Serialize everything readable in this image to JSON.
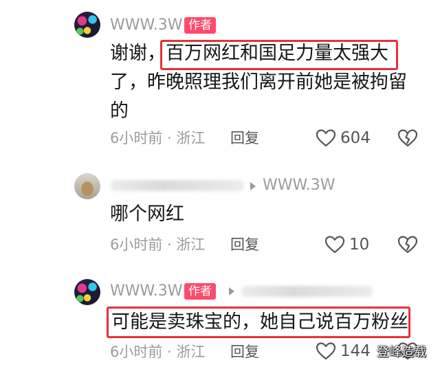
{
  "comments": [
    {
      "username": "WWW.3W",
      "author_tag": "作者",
      "text_line1_prefix": "谢谢，",
      "text_line1_highlight": "百万网红和国足力量太强大",
      "text_line2": "了，昨晚照理我们离开前她是被拘留",
      "text_line3": "的",
      "time_location": "6小时前 · 浙江",
      "reply_label": "回复",
      "likes": "604"
    },
    {
      "reply_to": "WWW.3W",
      "text": "哪个网红",
      "time_location": "6小时前 · 浙江",
      "reply_label": "回复",
      "likes": "10"
    },
    {
      "username": "WWW.3W",
      "author_tag": "作者",
      "text": "可能是卖珠宝的，她自己说百万粉丝",
      "time_location": "6小时前 · 浙江",
      "reply_label": "回复",
      "likes": "144"
    }
  ],
  "watermark": "登峰造载",
  "colors": {
    "author_tag": "#ff4a6c",
    "highlight_box": "#e8303a",
    "meta": "#9b9b9b"
  },
  "icons": {
    "like": "heart-outline-icon",
    "dislike": "broken-heart-icon"
  }
}
